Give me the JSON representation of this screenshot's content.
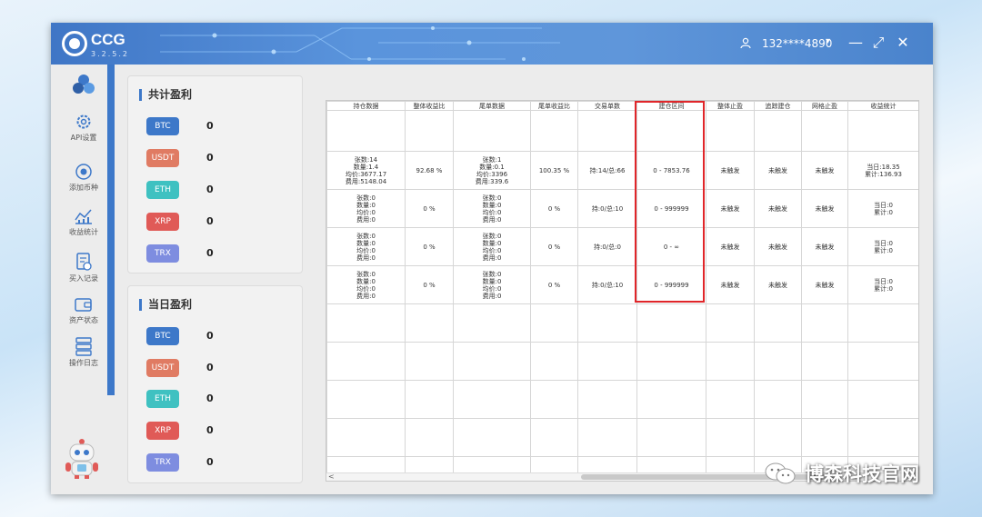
{
  "app": {
    "name": "CCG",
    "version": "3.2.5.2"
  },
  "user": {
    "name": "132****4890",
    "caret": "▾"
  },
  "window_controls": {
    "minimize": "—",
    "maximize": "⤢",
    "close": "✕"
  },
  "sidebar": {
    "items": [
      {
        "label": "API设置",
        "icon": "gear-icon"
      },
      {
        "label": "添加币种",
        "icon": "coin-add-icon"
      },
      {
        "label": "收益统计",
        "icon": "chart-icon"
      },
      {
        "label": "买入记录",
        "icon": "receipt-icon"
      },
      {
        "label": "资产状态",
        "icon": "wallet-icon"
      },
      {
        "label": "操作日志",
        "icon": "log-icon"
      }
    ]
  },
  "total_profit": {
    "title": "共计盈利",
    "coins": [
      {
        "name": "BTC",
        "value": "0",
        "color": "#3d78c9"
      },
      {
        "name": "USDT",
        "value": "0",
        "color": "#e07b63"
      },
      {
        "name": "ETH",
        "value": "0",
        "color": "#3fc1c1"
      },
      {
        "name": "XRP",
        "value": "0",
        "color": "#e05a57"
      },
      {
        "name": "TRX",
        "value": "0",
        "color": "#7e8de0"
      }
    ]
  },
  "daily_profit": {
    "title": "当日盈利",
    "coins": [
      {
        "name": "BTC",
        "value": "0",
        "color": "#3d78c9"
      },
      {
        "name": "USDT",
        "value": "0",
        "color": "#e07b63"
      },
      {
        "name": "ETH",
        "value": "0",
        "color": "#3fc1c1"
      },
      {
        "name": "XRP",
        "value": "0",
        "color": "#e05a57"
      },
      {
        "name": "TRX",
        "value": "0",
        "color": "#7e8de0"
      }
    ]
  },
  "table": {
    "headers": [
      "持仓数据",
      "整体收益比",
      "尾单数据",
      "尾单收益比",
      "交易单数",
      "建仓区间",
      "整体止盈",
      "追踪建仓",
      "网格止盈",
      "收益统计"
    ],
    "rows": [
      {
        "position": [
          "张数:14",
          "数量:1.4",
          "均价:3677.17",
          "费用:5148.04"
        ],
        "overall_ratio": "92.68 %",
        "tail": [
          "张数:1",
          "数量:0.1",
          "均价:3396",
          "费用:339.6"
        ],
        "tail_ratio": "100.35 %",
        "orders": "持:14/总:66",
        "range": "0 - 7853.76",
        "take_profit": "未触发",
        "trace": "未触发",
        "grid": "未触发",
        "stats": [
          "当日:18.35",
          "累计:136.93"
        ]
      },
      {
        "position": [
          "张数:0",
          "数量:0",
          "均价:0",
          "费用:0"
        ],
        "overall_ratio": "0 %",
        "tail": [
          "张数:0",
          "数量:0",
          "均价:0",
          "费用:0"
        ],
        "tail_ratio": "0 %",
        "orders": "持:0/总:10",
        "range": "0 - 999999",
        "take_profit": "未触发",
        "trace": "未触发",
        "grid": "未触发",
        "stats": [
          "当日:0",
          "累计:0"
        ]
      },
      {
        "position": [
          "张数:0",
          "数量:0",
          "均价:0",
          "费用:0"
        ],
        "overall_ratio": "0 %",
        "tail": [
          "张数:0",
          "数量:0",
          "均价:0",
          "费用:0"
        ],
        "tail_ratio": "0 %",
        "orders": "持:0/总:0",
        "range": "0 - ∞",
        "take_profit": "未触发",
        "trace": "未触发",
        "grid": "未触发",
        "stats": [
          "当日:0",
          "累计:0"
        ]
      },
      {
        "position": [
          "张数:0",
          "数量:0",
          "均价:0",
          "费用:0"
        ],
        "overall_ratio": "0 %",
        "tail": [
          "张数:0",
          "数量:0",
          "均价:0",
          "费用:0"
        ],
        "tail_ratio": "0 %",
        "orders": "持:0/总:10",
        "range": "0 - 999999",
        "take_profit": "未触发",
        "trace": "未触发",
        "grid": "未触发",
        "stats": [
          "当日:0",
          "累计:0"
        ]
      }
    ],
    "scroll_left": "<"
  },
  "watermark": {
    "text": "博森科技官网"
  }
}
